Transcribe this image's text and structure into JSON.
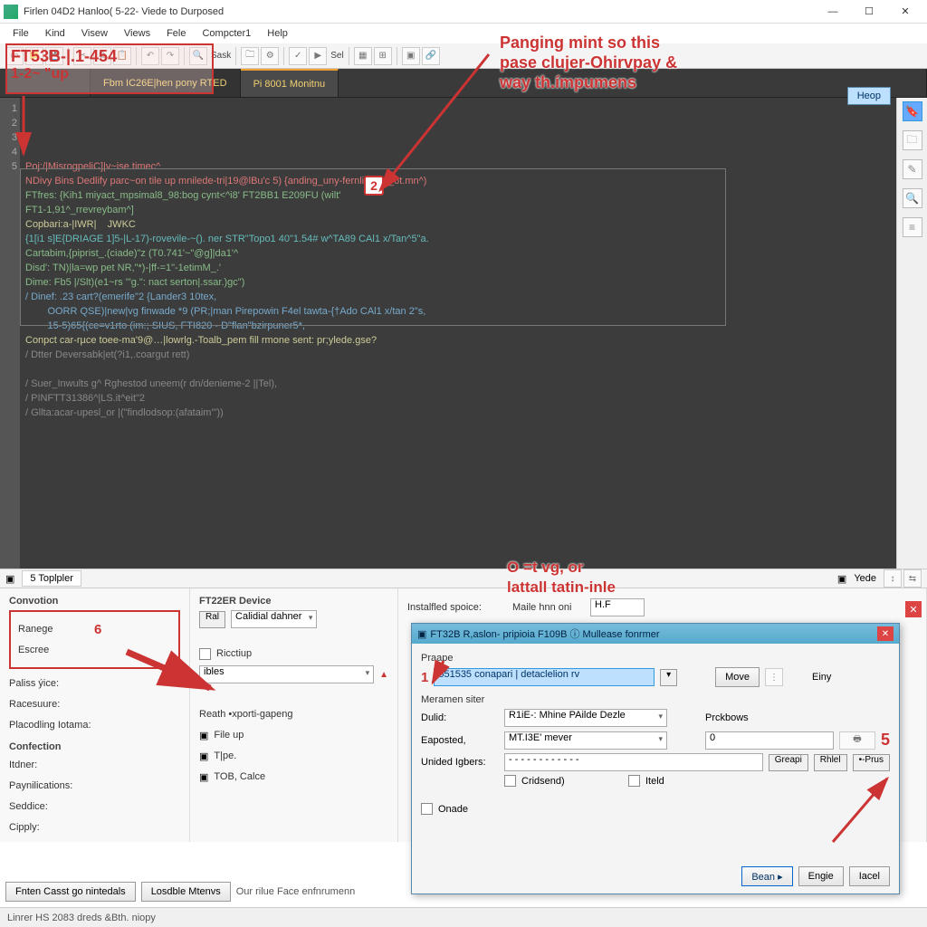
{
  "window": {
    "title": "Firlen 04D2 Hanloo( 5-22- Viede to Durposed"
  },
  "menu": [
    "File",
    "Kind",
    "Visew",
    "Views",
    "Fele",
    "Compcter1",
    "Help"
  ],
  "toolbar_labels": {
    "sask": "Sask",
    "sel": "Sel"
  },
  "tabs": [
    {
      "label": "",
      "icon": true
    },
    {
      "label": "Fbm IC26E|hen pony RTED"
    },
    {
      "label": "Pi 8001 Monitnu"
    },
    {
      "label": ""
    }
  ],
  "code": [
    {
      "cls": "c-pink",
      "t": "Poj:/|MisrogpeliC]|v~ise timec^"
    },
    {
      "cls": "c-pink",
      "t": "NDivy Bins Dedlify parc~on tile up mnilede-tri|19@lBu'c 5) {anding_uny-fernlinm_x_6t.mn^)"
    },
    {
      "cls": "c-green",
      "t": "FTfres: {Kih1 miyact_mpsimal8_98:bog cynt<^i8' FT2BB1 E209FU (wilt'"
    },
    {
      "cls": "c-green",
      "t": "FT1-1,91^_rrevreybam^]"
    },
    {
      "cls": "c-yellow",
      "t": "Copbari:a-|IWR|    JWKC"
    },
    {
      "cls": "c-teal",
      "t": "{1[i1 s]E{DRIAGE 1]5-|L-17)-rovevile-~(). ner STR\"Topo1 40\"1.54# w^TA89 CAl1 x/Tan^5\"a."
    },
    {
      "cls": "c-green",
      "t": "Cartabim,{piprist_.(ciade)\"z (T0.741'~\"@g]|da1'^"
    },
    {
      "cls": "c-green",
      "t": "Disd': TN)|la=wp pet NR,\"*)-|ff-=1\"-1etimM_.'"
    },
    {
      "cls": "c-green",
      "t": "Dime: Fb5 |/Slt)(e1~rs '\"g.\": nact serton|.ssar.)gc\")"
    },
    {
      "cls": "c-blue",
      "t": "/ Dinef: .23 cart?(emerife\"2 {Lander3 10tex,"
    },
    {
      "cls": "c-blue",
      "t": "        OORR QSE)|new|vg finwade *9 (PR;|man Pirepowin F4el tawta-{†Ado CAl1 x/tan 2\"s,"
    },
    {
      "cls": "c-blue",
      "t": "        15-5)65{(ce=v1rto (im:; SIUS, FTI820 - D\"flan\"bzirpuner5*,"
    },
    {
      "cls": "c-yellow",
      "t": "Conpct car-rµce toee-ma'9@…|lowrlg.-Toalb_pem fill rmone sent: pr;ylede.gse?"
    },
    {
      "cls": "c-gray",
      "t": "/ Dtter Deversabk|et(?i1,.coargut rett)"
    },
    {
      "cls": "",
      "t": ""
    },
    {
      "cls": "c-gray",
      "t": "/ Suer_Inwults g^ Rghestod uneem(r dn/denieme-2 ||Tel),"
    },
    {
      "cls": "c-gray",
      "t": "/ PINFTT31386^|LS.it^eit\"2"
    },
    {
      "cls": "c-gray",
      "t": "/ Gllta:acar-upesl_or |(\"findlodsop:(afataim'\"))"
    }
  ],
  "lower_tabs": {
    "left": "5 Toplpler",
    "right": "Yede"
  },
  "panel": {
    "convotion": "Convotion",
    "ranege": "Ranege",
    "escree": "Escree",
    "paliss": "Paliss ýice:",
    "racesure": "Racesuure:",
    "placoding": "Placodling Iotama:",
    "confection": "Confection",
    "itdner": "Itdner:",
    "payni": "Paynilications:",
    "seddice": "Seddice:",
    "cipply": "Cipply:",
    "device": "FT22ER Device",
    "ral": "Ral",
    "calidial": "Calidial dahner",
    "ricctup": "Ricctiup",
    "ibles": "ibles",
    "reath": "Reath •xporti-gapeng",
    "fileup": "File up",
    "tpe": "T|pe.",
    "tob": "TOB, Calce",
    "installed": "Instalfled spoice:",
    "maile": "Maile hnn oni",
    "hf": "H.F",
    "btn_fnten": "Fnten Casst go nintedals",
    "btn_losble": "Losdble Mtenvs",
    "our": "Our rilue Face enfnrumenn"
  },
  "dialog": {
    "title": "FT32B R,aslon- pripioia F109B ⓘ Mullease fonrmer",
    "praape": "Praape",
    "field1": "651535 conapari | detaclelion  rv",
    "move": "Move",
    "einy": "Einy",
    "meramen": "Meramen siter",
    "duld": "Dulid:",
    "duld_v": "R1iE-: Mhine PAilde Dezle",
    "eaposted": "Eaposted,",
    "eaposted_v": "MT.I3E' mever",
    "unided": "Unided Igbers:",
    "unided_v": "- - - - - - - - - - - -",
    "greapi": "Greapi",
    "rhlel": "Rhlel",
    "prus": "•-Prus",
    "crdsend": "Cridsend)",
    "iteld": "Iteld",
    "onde": "Onade",
    "prckbows": "Prckbows",
    "pb_v": "0",
    "bean": "Bean ▸",
    "engie": "Engie",
    "tacel": "Iacel"
  },
  "status": "Linrer HS 2083 dreds &Bth. niopy",
  "help": "Heop",
  "annotations": {
    "a1": "FT53B-|.1-454",
    "a1b": "1-2~ \"up",
    "a2": "Panging mint so this\npase clujer-Ohirvpay &\nway th.ímpumens",
    "a3": "O =t vg, or\nlattall tatin-inle",
    "n6": "6",
    "n1": "1",
    "n5": "5"
  }
}
